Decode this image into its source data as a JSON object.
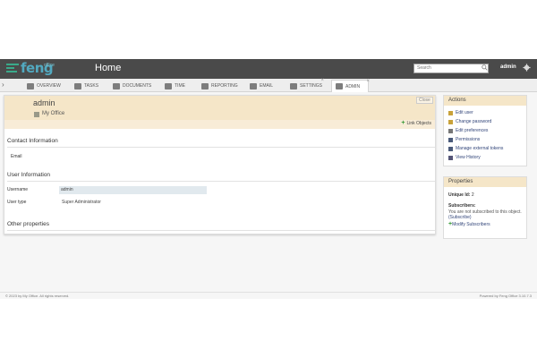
{
  "app": {
    "logo_text": "feng",
    "logo_sub": "office",
    "page_title": "Home",
    "search_placeholder": "Search",
    "user": "admin"
  },
  "tabs": [
    {
      "label": "OVERVIEW",
      "icon": "overview-icon"
    },
    {
      "label": "TASKS",
      "icon": "tasks-icon"
    },
    {
      "label": "DOCUMENTS",
      "icon": "documents-icon"
    },
    {
      "label": "TIME",
      "icon": "time-icon"
    },
    {
      "label": "REPORTING",
      "icon": "reporting-icon"
    },
    {
      "label": "EMAIL",
      "icon": "email-icon"
    },
    {
      "label": "SETTINGS",
      "icon": "gear-icon"
    },
    {
      "label": "ADMIN",
      "icon": "admin-icon"
    }
  ],
  "header": {
    "title": "admin",
    "workspace": "My Office",
    "close_label": "Close",
    "link_objects": "Link Objects"
  },
  "contact": {
    "section": "Contact Information",
    "email_label": "Email"
  },
  "user_info": {
    "section": "User Information",
    "username_label": "Username",
    "username_value": "admin",
    "type_label": "User type",
    "type_value": "Super Administrator"
  },
  "other": {
    "section": "Other properties"
  },
  "actions": {
    "title": "Actions",
    "items": [
      "Edit user",
      "Change password",
      "Edit preferences",
      "Permissions",
      "Manage external tokens",
      "View History"
    ]
  },
  "properties": {
    "title": "Properties",
    "unique_id_label": "Unique Id:",
    "unique_id_value": "2",
    "subscribers_label": "Subscribers:",
    "not_subscribed": "You are not subscribed to this object.",
    "subscribe_link": "(Subscribe)",
    "modify_subscribers": "Modify Subscribers"
  },
  "footer": {
    "left": "© 2023 by My Office. All rights reserved.",
    "right": "Powered by Feng Office 3.10.7.3"
  }
}
